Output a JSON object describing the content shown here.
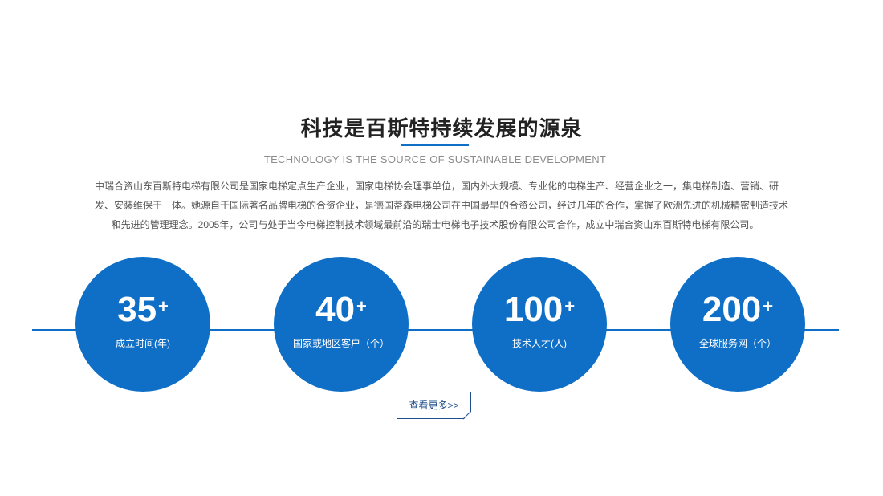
{
  "section": {
    "title": "科技是百斯特持续发展的源泉",
    "subtitle": "TECHNOLOGY IS THE SOURCE OF SUSTAINABLE DEVELOPMENT",
    "intro_lines": [
      "中瑞合资山东百斯特电梯有限公司是国家电梯定点生产企业，国家电梯协会理事单位，国内外大规模、专业化的电梯生产、经营企业之一，集电梯制造、营销、研",
      "发、安装维保于一体。她源自于国际著名品牌电梯的合资企业，是德国蒂森电梯公司在中国最早的合资公司，经过几年的合作，掌握了欧洲先进的机械精密制造技术",
      "和先进的管理理念。2005年，公司与处于当今电梯控制技术领域最前沿的瑞士电梯电子技术股份有限公司合作，成立中瑞合资山东百斯特电梯有限公司。"
    ]
  },
  "stats": [
    {
      "value": "35",
      "suffix": "+",
      "label": "成立时间(年)"
    },
    {
      "value": "40",
      "suffix": "+",
      "label": "国家或地区客户（个）"
    },
    {
      "value": "100",
      "suffix": "+",
      "label": "技术人才(人)"
    },
    {
      "value": "200",
      "suffix": "+",
      "label": "全球服务网（个）"
    }
  ],
  "more_button": {
    "label": "查看更多>>"
  },
  "colors": {
    "accent": "#0f6fc6",
    "button_border": "#1e4f8a"
  }
}
